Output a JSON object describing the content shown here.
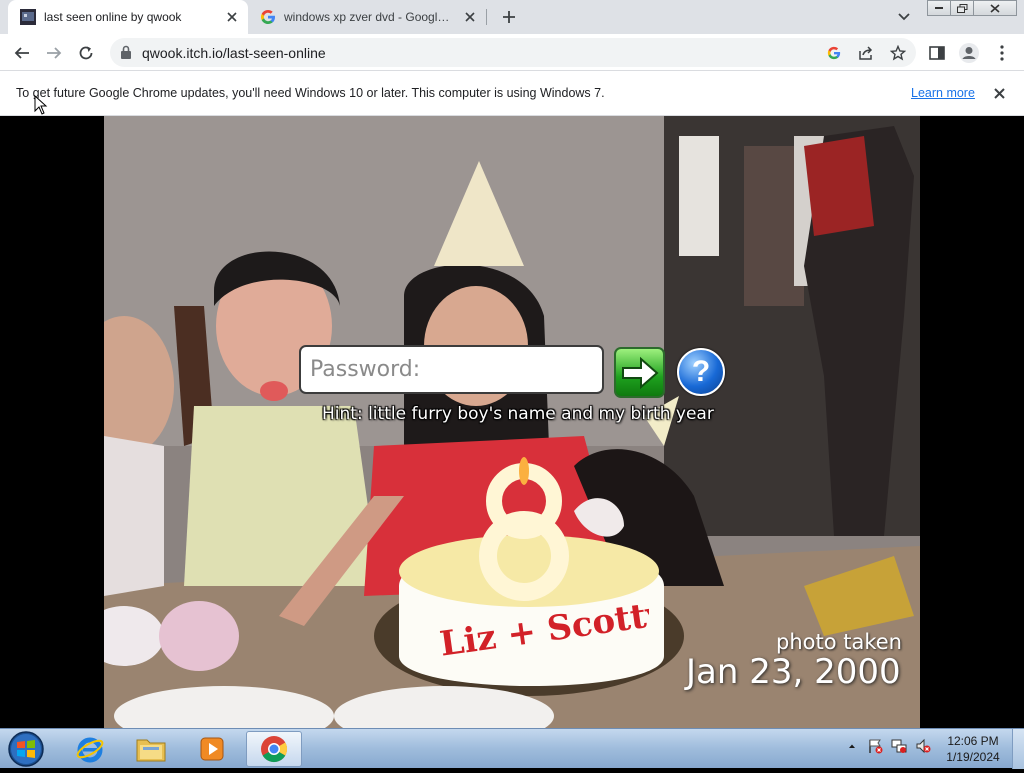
{
  "browser": {
    "tabs": [
      {
        "title": "last seen online by qwook",
        "active": true,
        "icon": "itchio-favicon"
      },
      {
        "title": "windows xp zver dvd - Google Se",
        "active": false,
        "icon": "google-favicon"
      }
    ],
    "new_tab_icon": "plus-icon",
    "url": "qwook.itch.io/last-seen-online"
  },
  "infobar": {
    "message": "To get future Google Chrome updates, you'll need Windows 10 or later. This computer is using Windows 7.",
    "link": "Learn more"
  },
  "game": {
    "password_placeholder": "Password:",
    "hint": "Hint: little furry boy's name and my birth year",
    "help_symbol": "?",
    "photo_label": "photo taken",
    "photo_date": "Jan 23, 2000",
    "cake_text": "Liz + Scotty",
    "candle_number": "8"
  },
  "taskbar": {
    "apps": [
      "internet-explorer",
      "windows-explorer",
      "media-player",
      "google-chrome"
    ],
    "time": "12:06 PM",
    "date": "1/19/2024"
  }
}
